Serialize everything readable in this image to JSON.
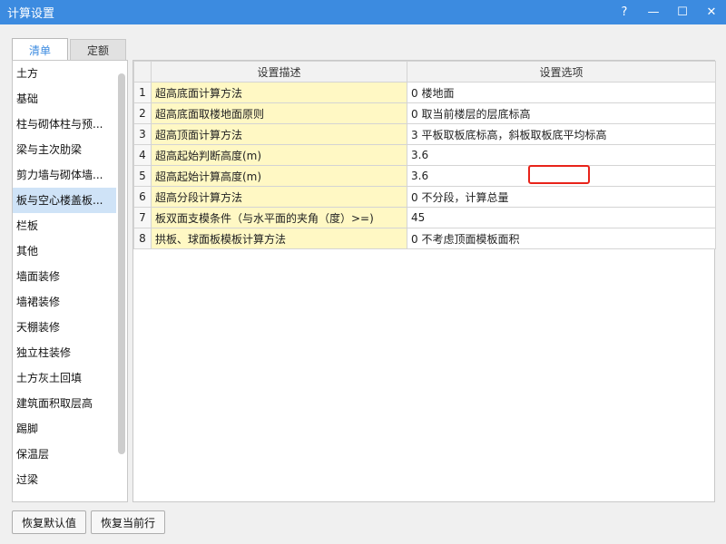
{
  "window": {
    "title": "计算设置",
    "controls": {
      "help": "?",
      "minimize": "—",
      "maximize": "☐",
      "close": "✕"
    }
  },
  "tabs": [
    {
      "label": "清单",
      "active": true
    },
    {
      "label": "定额",
      "active": false
    }
  ],
  "sidebar": {
    "items": [
      {
        "label": "土方"
      },
      {
        "label": "基础"
      },
      {
        "label": "柱与砌体柱与预..."
      },
      {
        "label": "梁与主次肋梁"
      },
      {
        "label": "剪力墙与砌体墙..."
      },
      {
        "label": "板与空心楼盖板...",
        "selected": true
      },
      {
        "label": "栏板"
      },
      {
        "label": "其他"
      },
      {
        "label": "墙面装修"
      },
      {
        "label": "墙裙装修"
      },
      {
        "label": "天棚装修"
      },
      {
        "label": "独立柱装修"
      },
      {
        "label": "土方灰土回填"
      },
      {
        "label": "建筑面积取层高"
      },
      {
        "label": "踢脚"
      },
      {
        "label": "保温层"
      },
      {
        "label": "过梁"
      }
    ]
  },
  "grid": {
    "columns": [
      "设置描述",
      "设置选项"
    ],
    "rows": [
      {
        "num": "1",
        "desc": "超高底面计算方法",
        "value": "0 楼地面"
      },
      {
        "num": "2",
        "desc": "超高底面取楼地面原则",
        "value": "0 取当前楼层的层底标高"
      },
      {
        "num": "3",
        "desc": "超高顶面计算方法",
        "value": "3 平板取板底标高，斜板取板底平均标高"
      },
      {
        "num": "4",
        "desc": "超高起始判断高度(m)",
        "value": "3.6"
      },
      {
        "num": "5",
        "desc": "超高起始计算高度(m)",
        "value": "3.6"
      },
      {
        "num": "6",
        "desc": "超高分段计算方法",
        "value": "0 不分段，计算总量"
      },
      {
        "num": "7",
        "desc": "板双面支模条件（与水平面的夹角（度）>=)",
        "value": "45"
      },
      {
        "num": "8",
        "desc": "拱板、球面板模板计算方法",
        "value": "0 不考虑顶面模板面积"
      }
    ]
  },
  "buttons": {
    "restore_default": "恢复默认值",
    "restore_current_row": "恢复当前行"
  },
  "colors": {
    "titlebar": "#3c8be0",
    "description_cell": "#fff8c4",
    "highlight": "#e8231a",
    "selected_item": "#cfe3f7"
  }
}
